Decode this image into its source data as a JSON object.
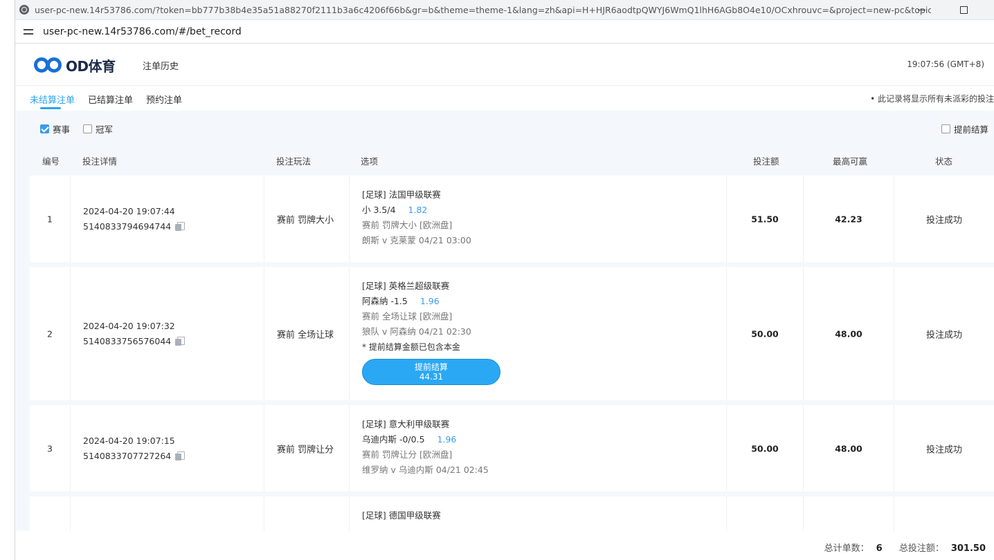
{
  "browser": {
    "title_url": "user-pc-new.14r53786.com/?token=bb777b38b4e35a51a88270f2111b3a6c4206f66b&gr=b&theme=theme-1&lang=zh&api=H+HJR6aodtpQWYJ6WmQ1lhH6AGb8O4e10/OCxhrouvc=&project=new-pc&topic=https%3A...",
    "address": "user-pc-new.14r53786.com/#/bet_record"
  },
  "header": {
    "logo_text": "OD体育",
    "page_title": "注单历史",
    "clock": "19:07:56 (GMT+8)"
  },
  "tabs": [
    {
      "label": "未结算注单",
      "active": true
    },
    {
      "label": "已结算注单",
      "active": false
    },
    {
      "label": "预约注单",
      "active": false
    }
  ],
  "tab_note": "• 此记录将显示所有未派彩的投注",
  "filters": {
    "match_label": "赛事",
    "match_checked": true,
    "champion_label": "冠军",
    "champion_checked": false,
    "early_settle_label": "提前结算",
    "early_settle_checked": false
  },
  "columns": [
    "编号",
    "投注详情",
    "投注玩法",
    "选项",
    "投注额",
    "最高可赢",
    "状态"
  ],
  "rows": [
    {
      "no": "1",
      "time": "2024-04-20 19:07:44",
      "order_id": "5140833794694744",
      "play": "赛前   罚牌大小",
      "league": "[足球] 法国甲级联赛",
      "pick": "小 3.5/4",
      "odds": "1.82",
      "market": "赛前  罚牌大小 [欧洲盘]",
      "match": "朗斯 v 克莱蒙    04/21 03:00",
      "stake": "51.50",
      "max_win": "42.23",
      "status": "投注成功"
    },
    {
      "no": "2",
      "time": "2024-04-20 19:07:32",
      "order_id": "5140833756576044",
      "play": "赛前   全场让球",
      "league": "[足球] 英格兰超级联赛",
      "pick": "阿森纳 -1.5",
      "odds": "1.96",
      "market": "赛前  全场让球 [欧洲盘]",
      "match": "狼队 v 阿森纳    04/21 02:30",
      "early_note": "* 提前结算金额已包含本金",
      "early_btn_label": "提前结算",
      "early_btn_amount": "44.31",
      "stake": "50.00",
      "max_win": "48.00",
      "status": "投注成功"
    },
    {
      "no": "3",
      "time": "2024-04-20 19:07:15",
      "order_id": "5140833707727264",
      "play": "赛前   罚牌让分",
      "league": "[足球] 意大利甲级联赛",
      "pick": "乌迪内斯 -0/0.5",
      "odds": "1.96",
      "market": "赛前  罚牌让分 [欧洲盘]",
      "match": "维罗纳 v 乌迪内斯    04/21 02:45",
      "stake": "50.00",
      "max_win": "48.00",
      "status": "投注成功"
    },
    {
      "league": "[足球] 德国甲级联赛"
    }
  ],
  "footer": {
    "count_label": "总计单数：",
    "count_value": "6",
    "total_label": "总投注额：",
    "total_value": "301.50"
  }
}
